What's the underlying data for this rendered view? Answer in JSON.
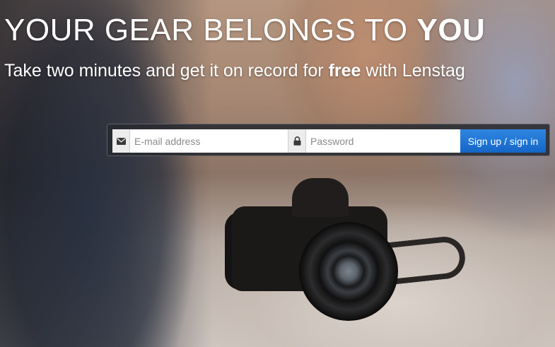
{
  "hero": {
    "headline_main": "YOUR GEAR BELONGS TO ",
    "headline_bold": "YOU",
    "sub_main": "Take two minutes and get it on record for ",
    "sub_bold": "free",
    "sub_tail": " with Lenstag"
  },
  "form": {
    "email_placeholder": "E-mail address",
    "email_value": "",
    "email_icon": "envelope-icon",
    "password_placeholder": "Password",
    "password_value": "",
    "password_icon": "lock-icon",
    "submit_label": "Sign up / sign in",
    "accent_color": "#1a6fd6"
  }
}
